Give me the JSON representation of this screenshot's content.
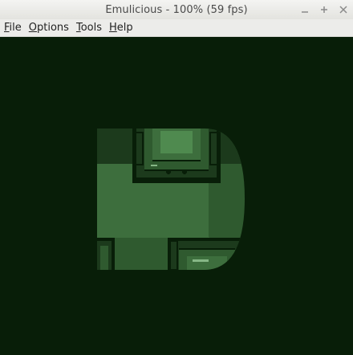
{
  "window": {
    "title": "Emulicious - 100% (59 fps)",
    "controls": [
      "minimize-icon",
      "maximize-icon",
      "close-icon"
    ]
  },
  "menu": {
    "items": [
      {
        "label": "File",
        "mnemonic": "F",
        "rest": "ile"
      },
      {
        "label": "Options",
        "mnemonic": "O",
        "rest": "ptions"
      },
      {
        "label": "Tools",
        "mnemonic": "T",
        "rest": "ools"
      },
      {
        "label": "Help",
        "mnemonic": "H",
        "rest": "elp"
      }
    ]
  },
  "screen": {
    "palette": {
      "darkest": "#081e08",
      "dark": "#1c3a1c",
      "mid": "#2f5a2f",
      "light": "#3d6e3d",
      "lighter": "#4f8a4f",
      "lightest": "#86b786"
    }
  }
}
